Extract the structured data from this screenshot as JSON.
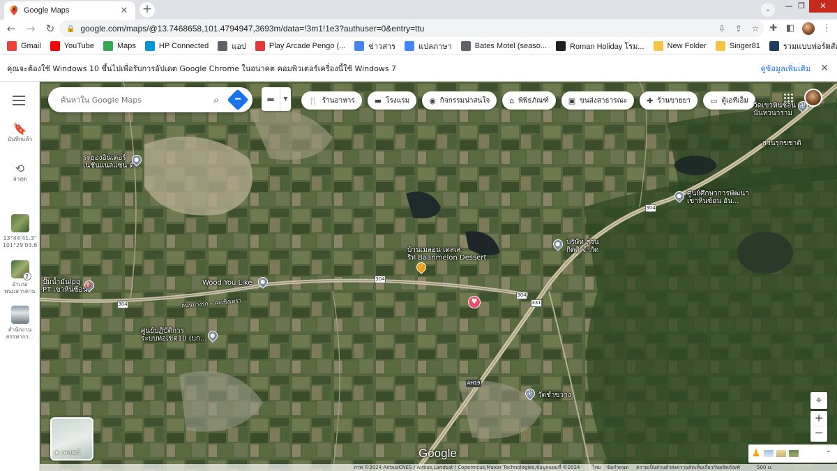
{
  "browser": {
    "tab_title": "Google Maps",
    "url": "google.com/maps/@13.7468658,101.4794947,3693m/data=!3m1!1e3?authuser=0&entry=ttu",
    "bookmarks": [
      {
        "label": "Gmail",
        "icon": "gmail-icon",
        "color": "#ea4335"
      },
      {
        "label": "YouTube",
        "icon": "youtube-icon",
        "color": "#ff0000"
      },
      {
        "label": "Maps",
        "icon": "maps-icon",
        "color": "#34a853"
      },
      {
        "label": "HP Connected",
        "icon": "hp-icon",
        "color": "#0096d6"
      },
      {
        "label": "แอป",
        "icon": "apps-grid-icon",
        "color": "#5f6368"
      },
      {
        "label": "Play Arcade Pengo (...",
        "icon": "arcade-icon",
        "color": "#e53935"
      },
      {
        "label": "ข่าวสาร",
        "icon": "news-icon",
        "color": "#4285f4"
      },
      {
        "label": "แปลภาษา",
        "icon": "translate-icon",
        "color": "#4285f4"
      },
      {
        "label": "Bates Motel (seaso...",
        "icon": "globe-icon",
        "color": "#5f6368"
      },
      {
        "label": "Roman Holiday โรม...",
        "icon": "film-icon",
        "color": "#202124"
      },
      {
        "label": "New Folder",
        "icon": "folder-icon",
        "color": "#f4c542"
      },
      {
        "label": "Singer81",
        "icon": "folder-icon",
        "color": "#f4c542"
      },
      {
        "label": "รวมแบบฟอร์มสัญญา...",
        "icon": "doc-icon",
        "color": "#1e3a5f"
      }
    ],
    "bookmarks_more": "»"
  },
  "infobar": {
    "message": "คุณจะต้องใช้ Windows 10 ขึ้นไปเพื่อรับการอัปเดต Google Chrome ในอนาคต คอมพิวเตอร์เครื่องนี้ใช้ Windows 7",
    "link": "ดูข้อมูลเพิ่มเติม",
    "close": "✕"
  },
  "rail": {
    "saved": "บันทึกแล้ว",
    "recent": "ล่าสุด",
    "recent_items": [
      {
        "line1": "13°44'41.3\"",
        "line2": "101°29'03.6"
      },
      {
        "line1": "อำเภอ",
        "line2": "พนมสารคาม",
        "badge": "2"
      },
      {
        "line1": "สำนักงาน",
        "line2": "สรรพากร..."
      }
    ]
  },
  "map": {
    "search_placeholder": "ค้นหาใน Google Maps",
    "chips": [
      {
        "label": "ร้านอาหาร",
        "icon": "restaurant-icon"
      },
      {
        "label": "โรงแรม",
        "icon": "hotel-icon"
      },
      {
        "label": "กิจกรรมน่าสนใจ",
        "icon": "camera-icon"
      },
      {
        "label": "พิพิธภัณฑ์",
        "icon": "museum-icon"
      },
      {
        "label": "ขนส่งสาธารณะ",
        "icon": "transit-icon"
      },
      {
        "label": "ร้านขายยา",
        "icon": "pharmacy-icon"
      },
      {
        "label": "ตู้เอทีเอ็ม",
        "icon": "atm-icon"
      }
    ],
    "places": [
      {
        "line1": "ระยองอินเตอร์",
        "line2": "เนชั่นแนลแซน ด์..."
      },
      {
        "line1": "ปั๊มน้ำมันlpg",
        "line2": "PT เขาหินซ้อน"
      },
      {
        "line1": "Wood You Like",
        "line2": ""
      },
      {
        "line1": "บ้านเมลอน เดสเส",
        "line2": "ริท Baanmelon Dessert"
      },
      {
        "line1": "บริษัท สวน",
        "line2": "กิตติ จำกัด"
      },
      {
        "line1": "ศูนย์ปฏิบัติการ",
        "line2": "ระบบท่อเขต10 (บก..."
      },
      {
        "line1": "วัดชำขวาง",
        "line2": ""
      },
      {
        "line1": "ศูนย์ศึกษาการพัฒนา",
        "line2": "เขาหินซ้อน อัน..."
      },
      {
        "line1": "วัดเขาหินซ้อน",
        "line2": "นันทวนาราม"
      },
      {
        "line1": "สวนรุกขชาติ",
        "line2": ""
      }
    ],
    "road_label": "ถนนบางรุก – ฉะเชิงเทรา",
    "route_shields": [
      "304",
      "304",
      "304",
      "331",
      "304"
    ],
    "ah_shield": "AH19",
    "layers_label": "เลเยอร์",
    "google": "Google",
    "footer": {
      "imagery": "ภาพ ©2024 AirbusCNES / Airbus,Landsat / Copernicus,Maxar Technologies,ข้อมูลแผนที่ ©2024",
      "thailand": "ไทย",
      "terms": "ข้อกำหนด",
      "privacy": "ความเป็นส่วนตัว",
      "feedback": "ส่งความคิดเห็นเกี่ยวกับผลิตภัณฑ์",
      "scale": "500 ม."
    }
  },
  "colors": {
    "accent": "#1a73e8",
    "chrome_tabstrip": "#dee1e6",
    "road": "#c8c0a8"
  }
}
